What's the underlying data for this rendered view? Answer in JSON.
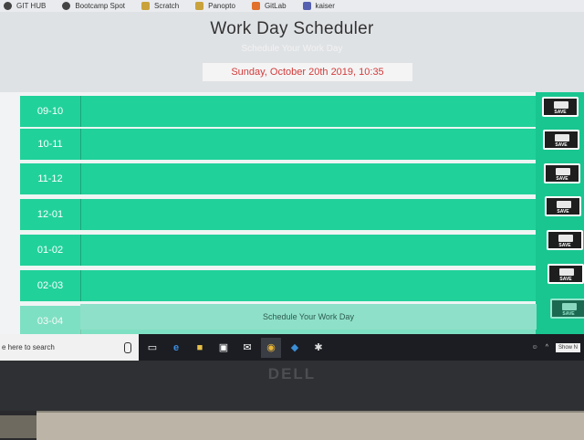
{
  "bookmarks": [
    {
      "label": "GIT HUB",
      "icon": "github-icon"
    },
    {
      "label": "Bootcamp Spot",
      "icon": "bootcamp-icon"
    },
    {
      "label": "Scratch",
      "icon": "scratch-icon"
    },
    {
      "label": "Panopto",
      "icon": "panopto-icon"
    },
    {
      "label": "GitLab",
      "icon": "gitlab-icon"
    },
    {
      "label": "kaiser",
      "icon": "kaiser-icon"
    }
  ],
  "header": {
    "title": "Work Day Scheduler",
    "subtitle": "Schedule Your Work Day",
    "date": "Sunday, October 20th 2019, 10:35"
  },
  "schedule": {
    "rows": [
      {
        "hour": "09-10"
      },
      {
        "hour": "10-11"
      },
      {
        "hour": "11-12"
      },
      {
        "hour": "12-01"
      },
      {
        "hour": "01-02"
      },
      {
        "hour": "02-03"
      },
      {
        "hour": "03-04"
      }
    ],
    "save_label": "SAVE",
    "footer_text": "Schedule Your Work Day"
  },
  "taskbar": {
    "search_placeholder": "e here to search",
    "show_desktop": "Show N"
  },
  "laptop": {
    "brand": "DELL"
  },
  "colors": {
    "row": "#21d19a",
    "date_text": "#d23b3b"
  }
}
